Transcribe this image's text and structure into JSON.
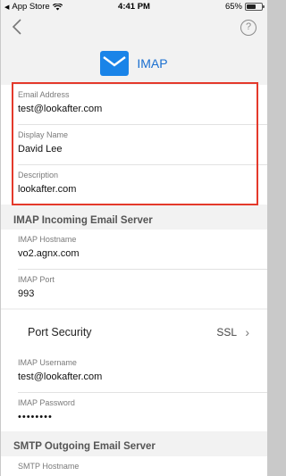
{
  "status": {
    "carrier": "App Store",
    "time": "4:41 PM",
    "battery": "65%",
    "battery_level": 0.65
  },
  "header": {
    "title": "IMAP",
    "help": "?"
  },
  "account": [
    {
      "label": "Email Address",
      "value": "test@lookafter.com"
    },
    {
      "label": "Display Name",
      "value": "David Lee"
    },
    {
      "label": "Description",
      "value": "lookafter.com"
    }
  ],
  "incoming": {
    "title": "IMAP Incoming Email Server",
    "hostname": {
      "label": "IMAP Hostname",
      "value": "vo2.agnx.com"
    },
    "port": {
      "label": "IMAP Port",
      "value": "993"
    },
    "security": {
      "label": "Port Security",
      "value": "SSL"
    },
    "username": {
      "label": "IMAP Username",
      "value": "test@lookafter.com"
    },
    "password": {
      "label": "IMAP Password",
      "value": "••••••••"
    }
  },
  "outgoing": {
    "title": "SMTP Outgoing Email Server",
    "hostname": {
      "label": "SMTP Hostname"
    }
  },
  "colors": {
    "accent": "#1a84e8",
    "highlight": "#e4392b"
  }
}
